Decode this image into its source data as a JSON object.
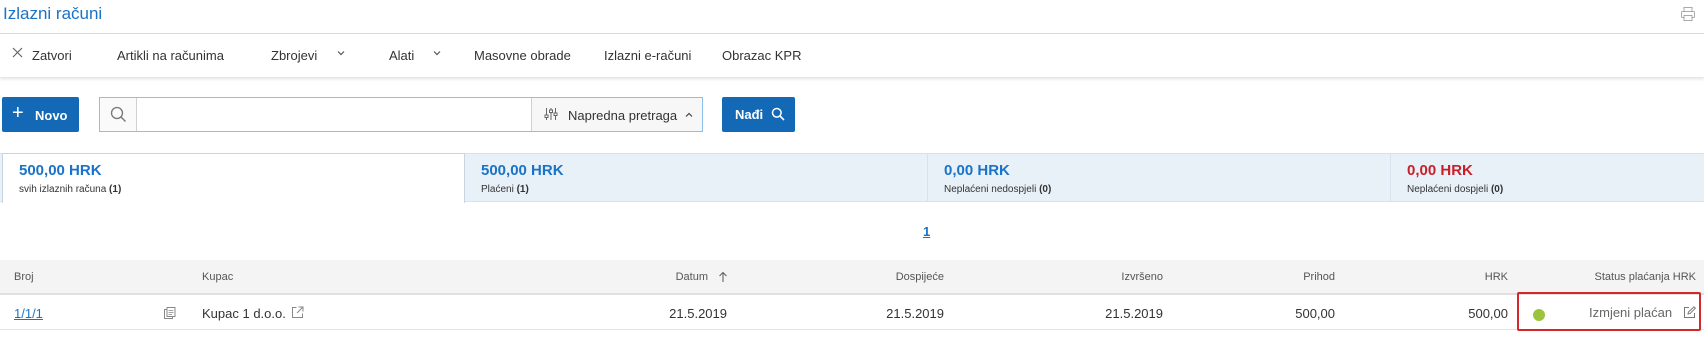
{
  "page": {
    "title": "Izlazni računi"
  },
  "toolbar": {
    "close_label": "Zatvori",
    "artikli_label": "Artikli na računima",
    "zbrojevi_label": "Zbrojevi",
    "alati_label": "Alati",
    "masovne_label": "Masovne obrade",
    "einvoice_label": "Izlazni e-računi",
    "kpr_label": "Obrazac KPR"
  },
  "actions": {
    "new_label": "Novo",
    "search_placeholder": "",
    "search_value": "",
    "advanced_search_label": "Napredna pretraga",
    "find_label": "Nađi"
  },
  "summary": [
    {
      "amount": "500,00 HRK",
      "label": "svih izlaznih računa",
      "count": "(1)",
      "color": "#1a73c6"
    },
    {
      "amount": "500,00 HRK",
      "label": "Plaćeni",
      "count": "(1)",
      "color": "#1a73c6"
    },
    {
      "amount": "0,00 HRK",
      "label": "Neplaćeni nedospjeli",
      "count": "(0)",
      "color": "#1a73c6"
    },
    {
      "amount": "0,00 HRK",
      "label": "Neplaćeni dospjeli",
      "count": "(0)",
      "color": "#c8202a"
    }
  ],
  "pagination": {
    "current_page": "1"
  },
  "table": {
    "headers": {
      "broj": "Broj",
      "kupac": "Kupac",
      "datum": "Datum",
      "dospijece": "Dospijeće",
      "izvrseno": "Izvršeno",
      "prihod": "Prihod",
      "hrk": "HRK",
      "status": "Status plaćanja HRK"
    },
    "sort_column": "Datum",
    "sort_direction": "ascending",
    "rows": [
      {
        "broj": "1/1/1",
        "kupac": "Kupac 1 d.o.o.",
        "datum": "21.5.2019",
        "dospijece": "21.5.2019",
        "izvrseno": "21.5.2019",
        "prihod": "500,00",
        "hrk": "500,00",
        "status_color": "#9bc43c",
        "status_action": "Izmjeni plaćan"
      }
    ]
  },
  "colors": {
    "primary": "#1469b6",
    "accent": "#1a73c6",
    "danger": "#c8202a",
    "paid": "#9bc43c"
  }
}
